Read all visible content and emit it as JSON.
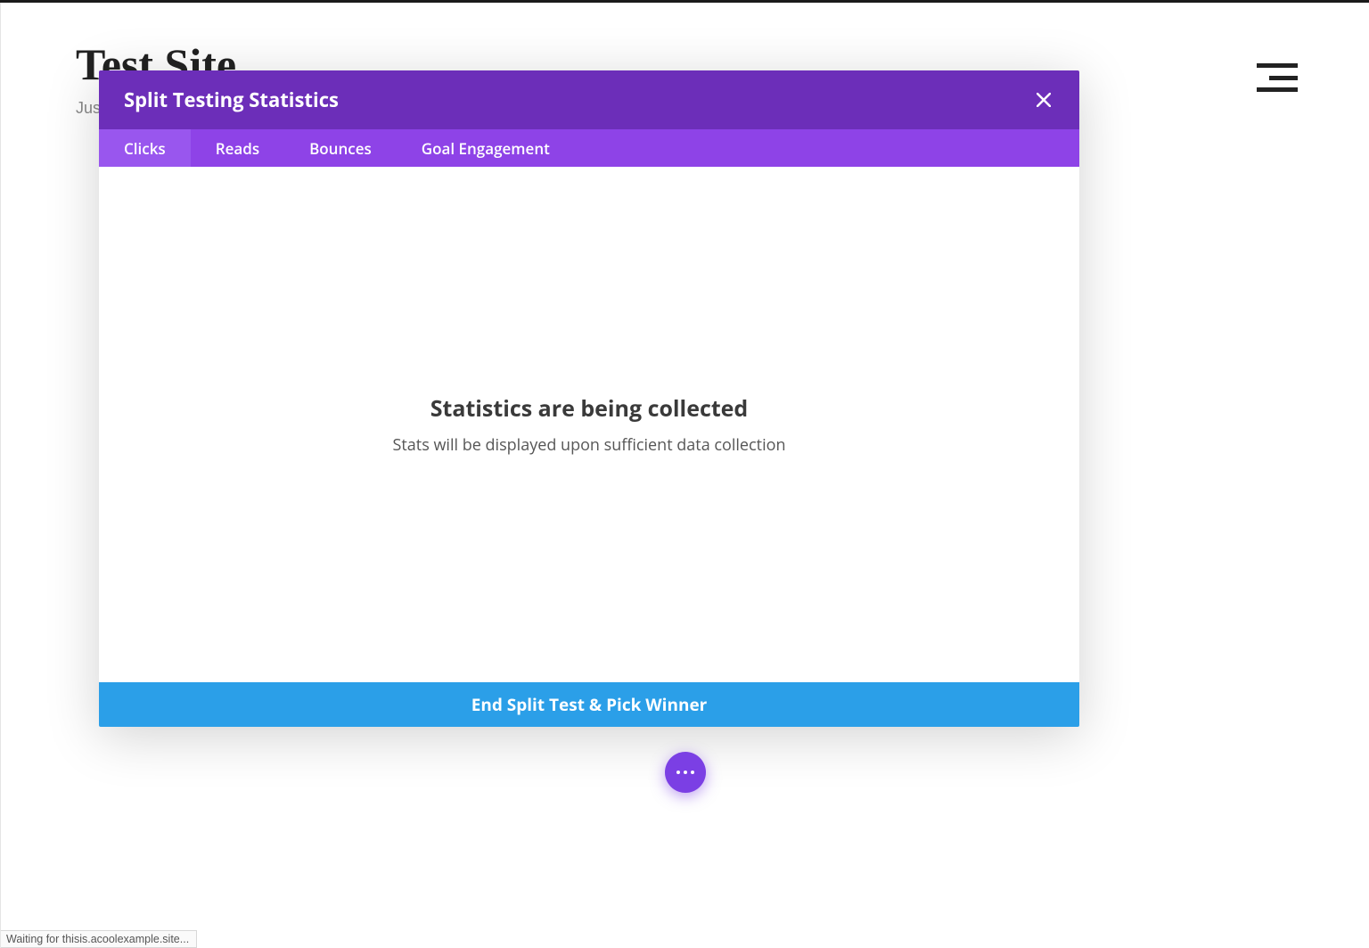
{
  "site": {
    "title": "Test Site",
    "tagline": "Jus"
  },
  "modal": {
    "title": "Split Testing Statistics",
    "tabs": [
      {
        "label": "Clicks",
        "active": true
      },
      {
        "label": "Reads",
        "active": false
      },
      {
        "label": "Bounces",
        "active": false
      },
      {
        "label": "Goal Engagement",
        "active": false
      }
    ],
    "body": {
      "heading": "Statistics are being collected",
      "subtext": "Stats will be displayed upon sufficient data collection"
    },
    "footer_button": "End Split Test & Pick Winner"
  },
  "status_bar": "Waiting for thisis.acoolexample.site...",
  "colors": {
    "modal_header": "#6c2eb9",
    "tabs_bg": "#8e43e7",
    "tab_active": "#9956ee",
    "footer_button": "#2b9fe8",
    "fab": "#7b3fe4"
  }
}
